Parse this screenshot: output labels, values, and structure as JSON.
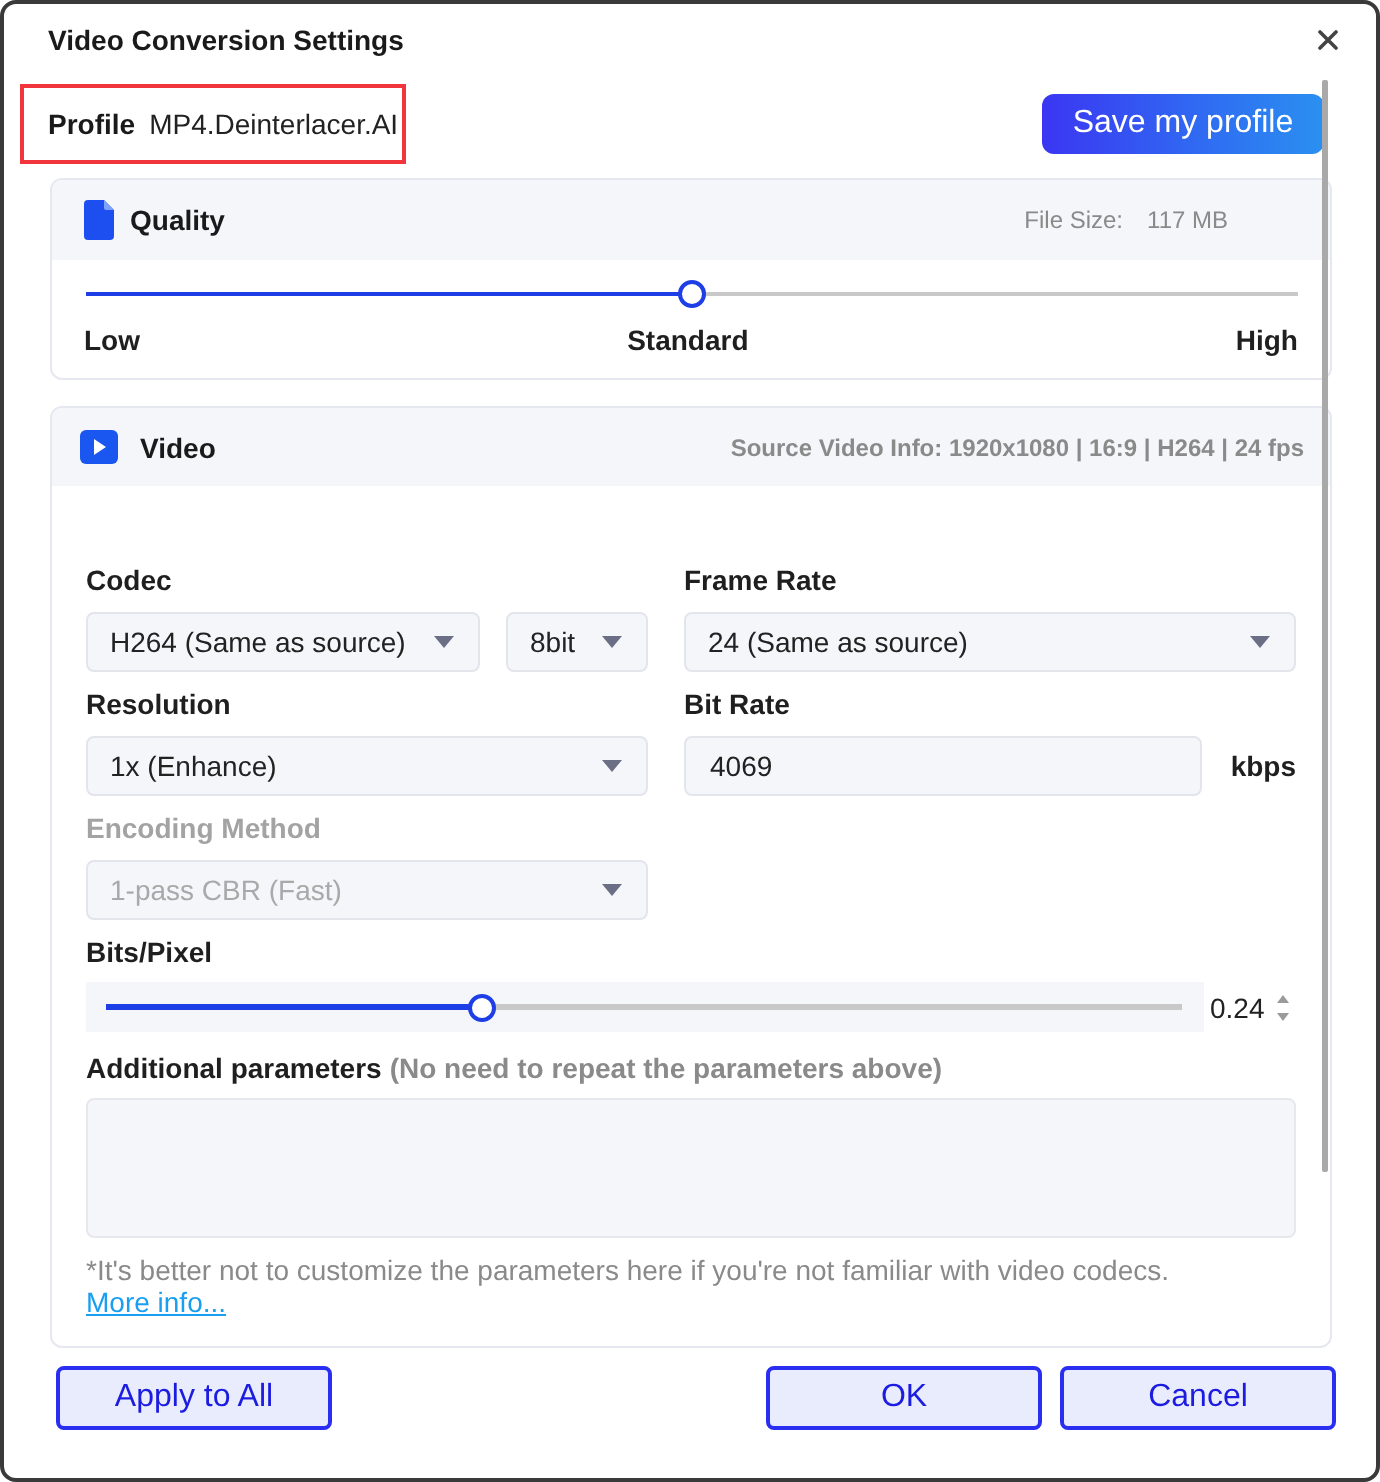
{
  "window": {
    "title": "Video Conversion Settings"
  },
  "profile": {
    "label": "Profile",
    "value": "MP4.Deinterlacer.AI",
    "highlighted": true
  },
  "save_button": {
    "label": "Save my profile"
  },
  "quality": {
    "title": "Quality",
    "file_size_label": "File Size:",
    "file_size": "117 MB",
    "level": 0.5,
    "marks": [
      "Low",
      "Standard",
      "High"
    ]
  },
  "video": {
    "title": "Video",
    "source_info": "Source Video Info: 1920x1080 | 16:9 | H264 | 24 fps",
    "codec": {
      "label": "Codec",
      "value": "H264 (Same as source)",
      "bit_depth": "8bit"
    },
    "frame_rate": {
      "label": "Frame Rate",
      "value": "24 (Same as source)"
    },
    "resolution": {
      "label": "Resolution",
      "value": "1x (Enhance)"
    },
    "bit_rate": {
      "label": "Bit Rate",
      "value": "4069",
      "unit": "kbps"
    },
    "encoding_method": {
      "label": "Encoding Method",
      "value": "1-pass CBR (Fast)",
      "disabled": true
    },
    "bits_per_pixel": {
      "label": "Bits/Pixel",
      "level": 0.35,
      "value": "0.24"
    },
    "additional_parameters": {
      "label": "Additional parameters",
      "hint": "(No need to repeat the parameters above)"
    },
    "note": {
      "text": "*It's better not to customize the parameters here if you're not familiar with video codecs.",
      "link": "More info..."
    }
  },
  "footer": {
    "left_buttons": [
      "Apply to All"
    ],
    "right_buttons": [
      "OK",
      "Cancel"
    ]
  }
}
